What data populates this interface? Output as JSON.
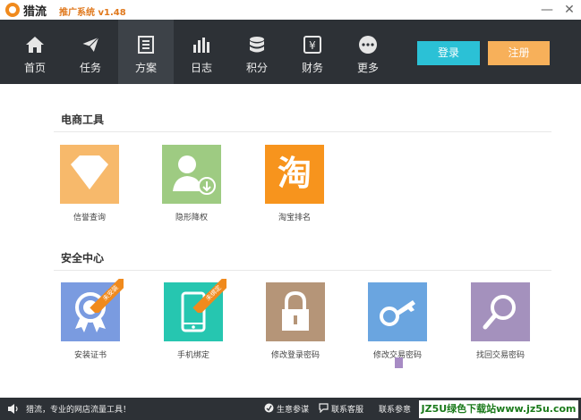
{
  "window": {
    "app_name": "猎流",
    "app_subtitle": "推广系统 v1.48",
    "minimize": "—",
    "close": "✕"
  },
  "nav": {
    "items": [
      {
        "label": "首页",
        "icon": "home-icon"
      },
      {
        "label": "任务",
        "icon": "paper-plane-icon"
      },
      {
        "label": "方案",
        "icon": "document-icon",
        "active": true
      },
      {
        "label": "日志",
        "icon": "bar-chart-icon"
      },
      {
        "label": "积分",
        "icon": "coins-icon"
      },
      {
        "label": "财务",
        "icon": "yuan-icon"
      },
      {
        "label": "更多",
        "icon": "more-icon"
      }
    ],
    "login": "登录",
    "register": "注册"
  },
  "sections": {
    "ecommerce": {
      "title": "电商工具",
      "tiles": [
        {
          "label": "信誉查询",
          "color": "#f7b96b",
          "icon": "diamond-icon"
        },
        {
          "label": "隐形降权",
          "color": "#9ecb82",
          "icon": "user-download-icon"
        },
        {
          "label": "淘宝排名",
          "color": "#f7941d",
          "icon": "taobao-icon",
          "glyph": "淘"
        }
      ]
    },
    "security": {
      "title": "安全中心",
      "tiles": [
        {
          "label": "安装证书",
          "color": "#7a9be0",
          "icon": "certificate-icon",
          "ribbon": "未安装"
        },
        {
          "label": "手机绑定",
          "color": "#26c6b0",
          "icon": "phone-icon",
          "ribbon": "未绑定"
        },
        {
          "label": "修改登录密码",
          "color": "#b59578",
          "icon": "lock-icon"
        },
        {
          "label": "修改交易密码",
          "color": "#6aa5e0",
          "icon": "key-icon"
        },
        {
          "label": "找回交易密码",
          "color": "#a491bd",
          "icon": "search-icon"
        }
      ]
    }
  },
  "status": {
    "tagline": "猎流，专业的网店流量工具！",
    "feedback": "生意参谋",
    "support": "联系客服",
    "support2": "联系参意",
    "watermark": "JZ5U绿色下载站www.jz5u.com"
  }
}
